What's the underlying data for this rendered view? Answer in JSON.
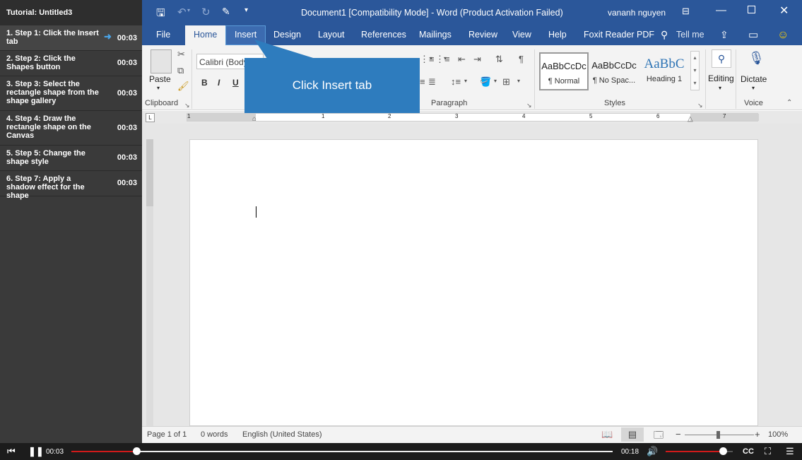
{
  "sidebar": {
    "title": "Tutorial: Untitled3",
    "steps": [
      {
        "label": "1. Step 1: Click the Insert tab",
        "duration": "00:03"
      },
      {
        "label": "2. Step 2: Click the Shapes button",
        "duration": "00:03"
      },
      {
        "label": "3. Step 3: Select the rectangle shape from the shape gallery",
        "duration": "00:03"
      },
      {
        "label": "4. Step 4: Draw the rectangle shape on the Canvas",
        "duration": "00:03"
      },
      {
        "label": "5. Step 5: Change the shape style",
        "duration": "00:03"
      },
      {
        "label": "6. Step 7: Apply a shadow effect for the shape",
        "duration": "00:03"
      }
    ]
  },
  "titlebar": {
    "doc_title": "Document1 [Compatibility Mode]  -  Word (Product Activation Failed)",
    "user": "vananh nguyen"
  },
  "tabs": [
    "File",
    "Home",
    "Insert",
    "Design",
    "Layout",
    "References",
    "Mailings",
    "Review",
    "View",
    "Help",
    "Foxit Reader PDF"
  ],
  "tell_me": "Tell me",
  "ribbon": {
    "paste_label": "Paste",
    "font_name": "Calibri (Body",
    "bold": "B",
    "italic": "I",
    "underline": "U",
    "groups": {
      "clipboard": "Clipboard",
      "paragraph": "Paragraph",
      "styles": "Styles",
      "voice": "Voice"
    },
    "styles": [
      {
        "sample": "AaBbCcDc",
        "name": "¶ Normal"
      },
      {
        "sample": "AaBbCcDc",
        "name": "¶ No Spac..."
      },
      {
        "sample": "AaBbC",
        "name": "Heading 1"
      }
    ],
    "editing_label": "Editing",
    "dictate_label": "Dictate"
  },
  "callout": {
    "text": "Click Insert tab"
  },
  "statusbar": {
    "page": "Page 1 of 1",
    "words": "0 words",
    "language": "English (United States)",
    "zoom": "100%"
  },
  "ruler_numbers": [
    "1",
    "1",
    "2",
    "3",
    "4",
    "5",
    "6",
    "7"
  ],
  "player": {
    "current_time": "00:03",
    "total_time": "00:18",
    "cc_label": "CC",
    "progress": 0.12,
    "volume": 0.85
  },
  "colors": {
    "word_blue": "#2b579a",
    "callout_blue": "#2e7cbe",
    "progress_red": "#d11a1a"
  }
}
